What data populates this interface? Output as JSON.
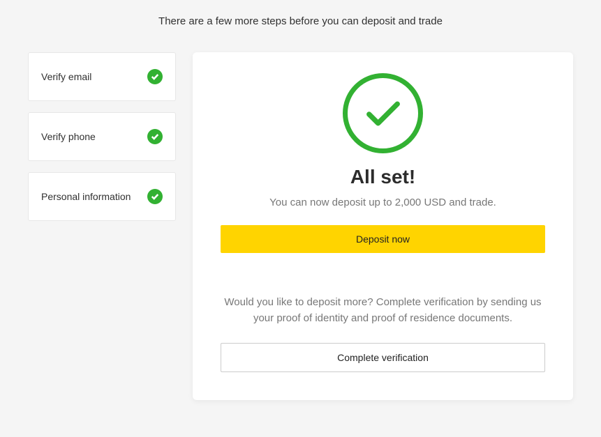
{
  "header": {
    "text": "There are a few more steps before you can deposit and trade"
  },
  "sidebar": {
    "steps": [
      {
        "label": "Verify email",
        "done": true
      },
      {
        "label": "Verify phone",
        "done": true
      },
      {
        "label": "Personal information",
        "done": true
      }
    ]
  },
  "main": {
    "title": "All set!",
    "subtitle": "You can now deposit up to 2,000 USD and trade.",
    "deposit_button": "Deposit now",
    "more_text": "Would you like to deposit more? Complete verification by sending us your proof of identity and proof of residence documents.",
    "complete_button": "Complete verification"
  }
}
